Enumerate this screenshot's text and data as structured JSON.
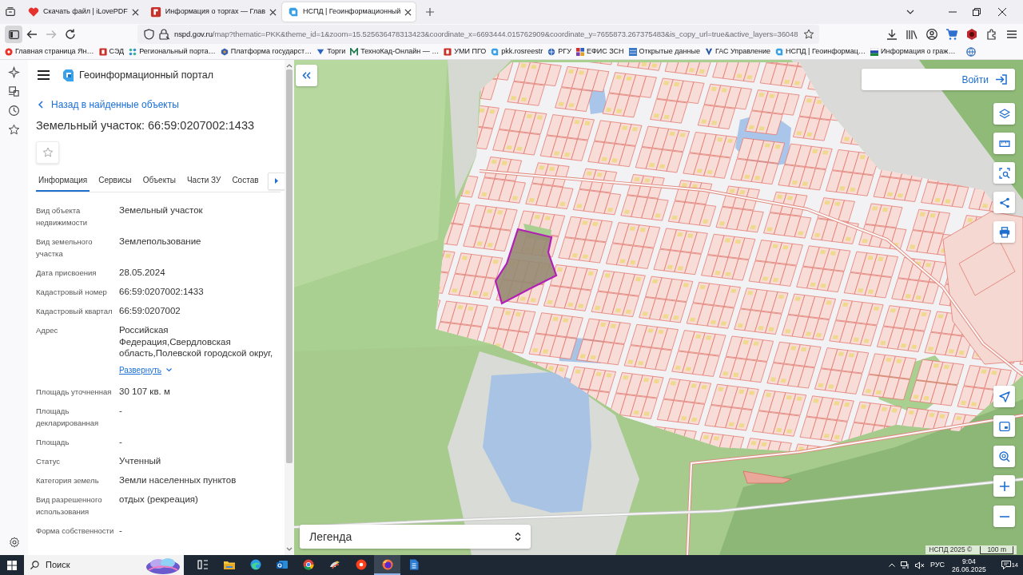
{
  "browser": {
    "tabs": [
      {
        "title": "Скачать файл | iLovePDF",
        "selected": false
      },
      {
        "title": "Информация о торгах — Глав",
        "selected": false
      },
      {
        "title": "НСПД | Геоинформационный",
        "selected": true
      }
    ],
    "nav_buttons": [
      {
        "kind": "back",
        "disabled": false
      },
      {
        "kind": "forward",
        "disabled": true
      },
      {
        "kind": "reload",
        "disabled": false
      }
    ],
    "address": {
      "host": "nspd.gov.ru",
      "path": "/map?thematic=PKK&theme_id=1&zoom=15.525636478313423&coordinate_x=6693444.015762909&coordinate_y=7655873.267375483&is_copy_url=true&active_layers=36048"
    },
    "bookmarks": [
      "Главная страница Ян…",
      "СЭД",
      "Региональный порта…",
      "Платформа государст…",
      "Торги",
      "ТехноКад-Онлайн — …",
      "УМИ ПГО",
      "pkk.rosreestr",
      "РГУ",
      "ЕФИС ЗСН",
      "Открытые данные",
      "ГАС Управление",
      "НСПД | Геоинформац…",
      "Информация о граж…"
    ]
  },
  "portal": {
    "title": "Геоинформационный портал",
    "back_link": "Назад в найденные объекты",
    "heading": "Земельный участок: 66:59:0207002:1433",
    "starred": false,
    "tabs": [
      {
        "label": "Информация",
        "selected": true
      },
      {
        "label": "Сервисы",
        "selected": false
      },
      {
        "label": "Объекты",
        "selected": false
      },
      {
        "label": "Части ЗУ",
        "selected": false
      },
      {
        "label": "Состав",
        "selected": false
      }
    ],
    "properties": [
      {
        "label": "Вид объекта недвижимости",
        "value": "Земельный участок"
      },
      {
        "label": "Вид земельного участка",
        "value": "Землепользование"
      },
      {
        "label": "Дата присвоения",
        "value": "28.05.2024"
      },
      {
        "label": "Кадастровый номер",
        "value": "66:59:0207002:1433"
      },
      {
        "label": "Кадастровый квартал",
        "value": "66:59:0207002"
      },
      {
        "label": "Адрес",
        "value": "Российская Федерация,Свердловская область,Полевской городской округ,",
        "expand_link": "Развернуть"
      },
      {
        "label": "Площадь уточненная",
        "value": "30 107 кв. м"
      },
      {
        "label": "Площадь декларированная",
        "value": "-"
      },
      {
        "label": "Площадь",
        "value": "-"
      },
      {
        "label": "Статус",
        "value": "Учтенный"
      },
      {
        "label": "Категория земель",
        "value": "Земли населенных пунктов"
      },
      {
        "label": "Вид разрешенного использования",
        "value": "отдых (рекреация)"
      },
      {
        "label": "Форма собственности",
        "value": "-"
      }
    ]
  },
  "map": {
    "login": "Войти",
    "legend": "Легенда",
    "attribution": "НСПД 2025 ©",
    "scale": "100 m"
  },
  "taskbar": {
    "search": {
      "placeholder": "Поиск"
    },
    "apps": [
      {
        "kind": "taskview",
        "selected": false
      },
      {
        "kind": "folder",
        "selected": false
      },
      {
        "kind": "wave",
        "selected": false
      },
      {
        "kind": "mail",
        "selected": false
      },
      {
        "kind": "ring",
        "selected": false
      },
      {
        "kind": "fan",
        "selected": false
      },
      {
        "kind": "disc",
        "selected": false
      },
      {
        "kind": "globe",
        "selected": true
      },
      {
        "kind": "document",
        "selected": false
      }
    ],
    "language": "РУС",
    "time": "9:04",
    "date": "26.06.2025",
    "notifications": "14"
  }
}
